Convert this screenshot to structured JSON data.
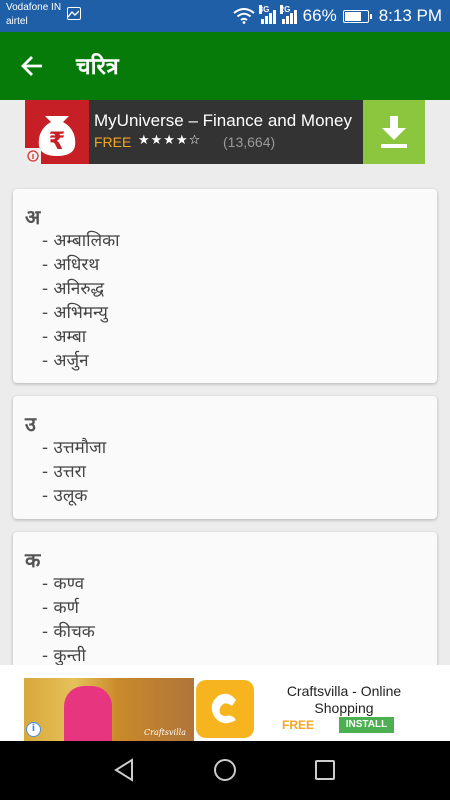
{
  "status_bar": {
    "carrier_1": "Vodafone IN",
    "carrier_2": "airtel",
    "net_1": "3G",
    "net_2": "2G",
    "battery_percent": "66%",
    "battery_level": 0.66,
    "time": "8:13 PM",
    "background": "#1f5fa8"
  },
  "app_bar": {
    "title": "चरित्र",
    "background": "#077b0a",
    "back_icon": "arrow-left-icon"
  },
  "ad_top": {
    "title": "MyUniverse – Finance and Money",
    "price": "FREE",
    "stars": "★★★★☆",
    "rating": 4,
    "review_count": "(13,664)",
    "icon": "rupee-bag-icon",
    "action_icon": "download-icon"
  },
  "sections": [
    {
      "letter": "अ",
      "items": [
        "- अम्बालिका",
        "- अधिरथ",
        "- अनिरुद्ध",
        "- अभिमन्यु",
        "- अम्बा",
        "- अर्जुन"
      ]
    },
    {
      "letter": "उ",
      "items": [
        "- उत्तमौजा",
        "- उत्तरा",
        "- उलूक"
      ]
    },
    {
      "letter": "क",
      "items": [
        "- कण्व",
        "- कर्ण",
        "- कीचक",
        "- कुन्ती"
      ]
    }
  ],
  "ad_bottom": {
    "title": "Craftsvilla - Online Shopping",
    "price": "FREE",
    "install_label": "INSTALL",
    "photo_brand": "Craftsvilla",
    "icon": "craftsvilla-logo-icon"
  },
  "nav_bar": {
    "back_icon": "triangle-back-icon",
    "home_icon": "circle-home-icon",
    "recents_icon": "square-recents-icon"
  }
}
